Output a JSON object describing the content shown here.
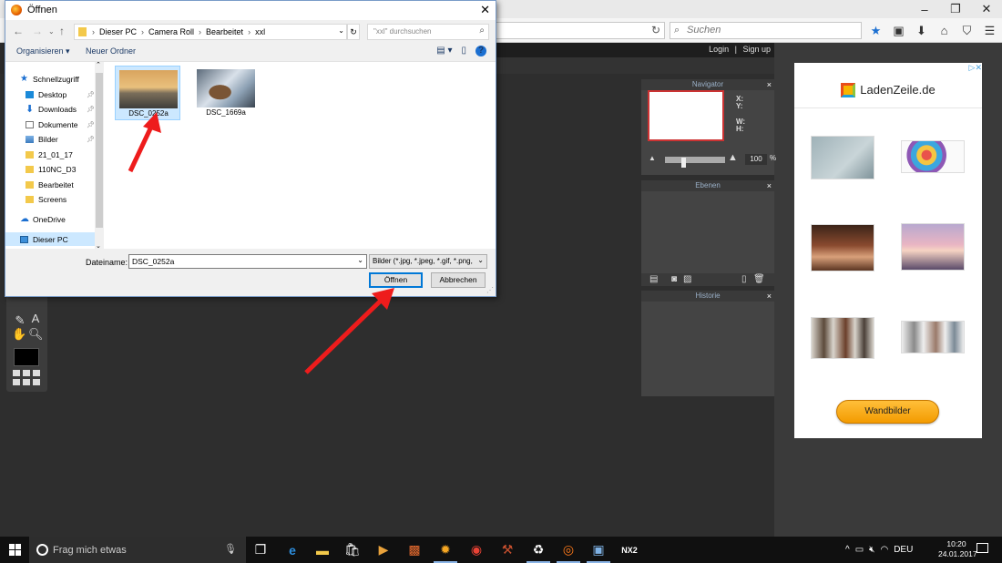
{
  "browser": {
    "search_placeholder": "Suchen",
    "window_buttons": [
      "–",
      "❐",
      "✕"
    ],
    "toolbar_icons": [
      "star-icon",
      "clipboard-icon",
      "download-icon",
      "home-icon",
      "pocket-icon",
      "menu-icon"
    ]
  },
  "site": {
    "login": "Login",
    "separator": "|",
    "signup": "Sign up"
  },
  "panels": {
    "navigator": {
      "title": "Navigator",
      "x_label": "X:",
      "y_label": "Y:",
      "w_label": "W:",
      "h_label": "H:",
      "zoom_value": "100",
      "zoom_unit": "%",
      "zoom_level_fraction": 0.3
    },
    "layers": {
      "title": "Ebenen"
    },
    "history": {
      "title": "Historie"
    },
    "close": "×"
  },
  "ad": {
    "brand": "LadenZeile.de",
    "button": "Wandbilder",
    "ad_badge": "▷✕"
  },
  "dialog": {
    "title": "Öffnen",
    "close": "✕",
    "breadcrumbs": [
      "Dieser PC",
      "Camera Roll",
      "Bearbeitet",
      "xxl"
    ],
    "breadcrumb_sep": "›",
    "search_placeholder": "\"xxl\" durchsuchen",
    "organize": "Organisieren ▾",
    "new_folder": "Neuer Ordner",
    "nav_items": [
      {
        "label": "Schnellzugriff",
        "icon": "star-icon",
        "pinned": false
      },
      {
        "label": "Desktop",
        "icon": "desktop-icon",
        "pinned": true
      },
      {
        "label": "Downloads",
        "icon": "download-icon",
        "pinned": true
      },
      {
        "label": "Dokumente",
        "icon": "document-icon",
        "pinned": true
      },
      {
        "label": "Bilder",
        "icon": "pictures-icon",
        "pinned": true
      },
      {
        "label": "21_01_17",
        "icon": "folder-icon",
        "pinned": false
      },
      {
        "label": "110NC_D3",
        "icon": "folder-icon",
        "pinned": false
      },
      {
        "label": "Bearbeitet",
        "icon": "folder-icon",
        "pinned": false
      },
      {
        "label": "Screens",
        "icon": "folder-icon",
        "pinned": false
      },
      {
        "label": "OneDrive",
        "icon": "cloud-icon",
        "pinned": false
      },
      {
        "label": "Dieser PC",
        "icon": "computer-icon",
        "pinned": false
      }
    ],
    "files": [
      {
        "name": "DSC_0252a",
        "selected": true
      },
      {
        "name": "DSC_1669a",
        "selected": false
      }
    ],
    "filename_label": "Dateiname:",
    "filename_value": "DSC_0252a",
    "filetype_value": "Bilder (*.jpg, *.jpeg, *.gif, *.png,",
    "open_button": "Öffnen",
    "cancel_button": "Abbrechen"
  },
  "taskbar": {
    "search_placeholder": "Frag mich etwas",
    "language": "DEU",
    "time": "10:20",
    "date": "24.01.2017",
    "apps": [
      "task-view-icon",
      "edge-icon",
      "explorer-icon",
      "store-icon",
      "media-icon",
      "photo-app-icon",
      "settings-app-icon",
      "chrome-icon",
      "tool-app-icon",
      "recycle-app-icon",
      "firefox-icon",
      "window-app-icon",
      "nx2-app-icon"
    ]
  },
  "colors": {
    "dialog_accent": "#0078d7",
    "selection": "#cce8ff",
    "annotation_arrow": "#ee1c1c",
    "ad_button": "#f39b00"
  }
}
